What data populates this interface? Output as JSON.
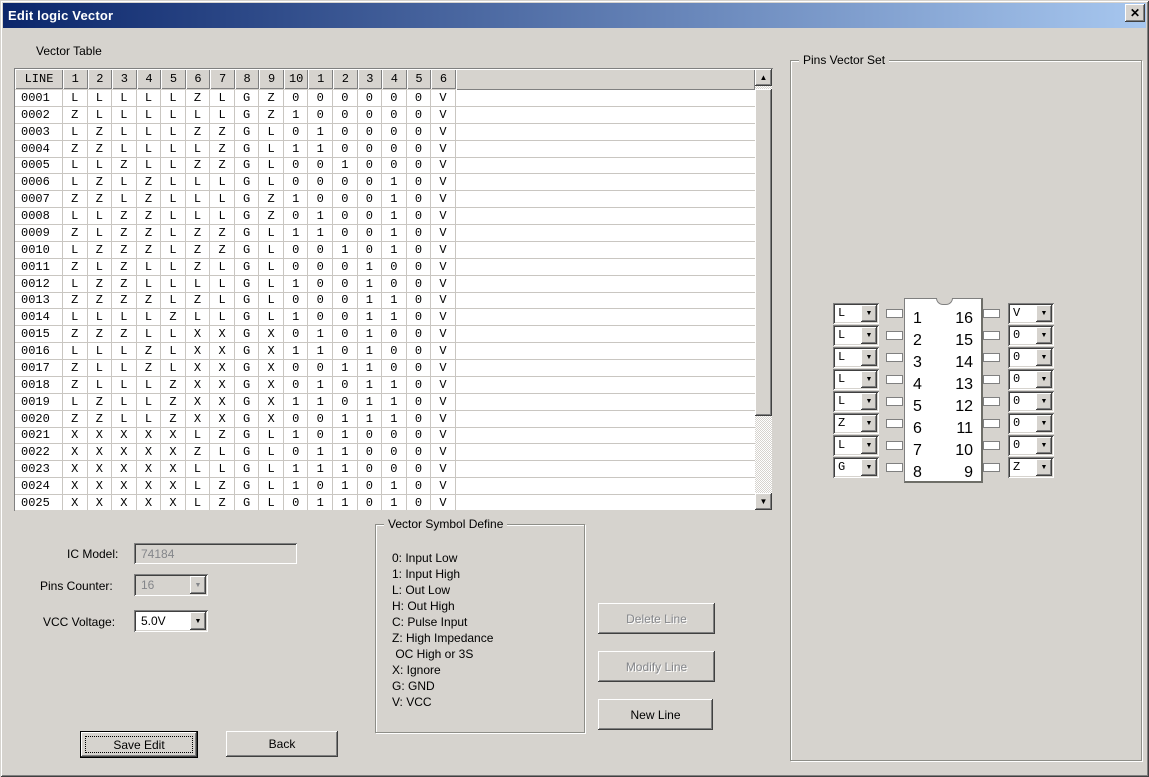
{
  "window": {
    "title": "Edit logic Vector",
    "close_glyph": "✕"
  },
  "vector_table": {
    "label": "Vector Table",
    "columns": [
      "LINE",
      "1",
      "2",
      "3",
      "4",
      "5",
      "6",
      "7",
      "8",
      "9",
      "10",
      "1",
      "2",
      "3",
      "4",
      "5",
      "6"
    ],
    "rows": [
      [
        "0001",
        "L",
        "L",
        "L",
        "L",
        "L",
        "Z",
        "L",
        "G",
        "Z",
        "0",
        "0",
        "0",
        "0",
        "0",
        "0",
        "V"
      ],
      [
        "0002",
        "Z",
        "L",
        "L",
        "L",
        "L",
        "L",
        "L",
        "G",
        "Z",
        "1",
        "0",
        "0",
        "0",
        "0",
        "0",
        "V"
      ],
      [
        "0003",
        "L",
        "Z",
        "L",
        "L",
        "L",
        "Z",
        "Z",
        "G",
        "L",
        "0",
        "1",
        "0",
        "0",
        "0",
        "0",
        "V"
      ],
      [
        "0004",
        "Z",
        "Z",
        "L",
        "L",
        "L",
        "L",
        "Z",
        "G",
        "L",
        "1",
        "1",
        "0",
        "0",
        "0",
        "0",
        "V"
      ],
      [
        "0005",
        "L",
        "L",
        "Z",
        "L",
        "L",
        "Z",
        "Z",
        "G",
        "L",
        "0",
        "0",
        "1",
        "0",
        "0",
        "0",
        "V"
      ],
      [
        "0006",
        "L",
        "Z",
        "L",
        "Z",
        "L",
        "L",
        "L",
        "G",
        "L",
        "0",
        "0",
        "0",
        "0",
        "1",
        "0",
        "V"
      ],
      [
        "0007",
        "Z",
        "Z",
        "L",
        "Z",
        "L",
        "L",
        "L",
        "G",
        "Z",
        "1",
        "0",
        "0",
        "0",
        "1",
        "0",
        "V"
      ],
      [
        "0008",
        "L",
        "L",
        "Z",
        "Z",
        "L",
        "L",
        "L",
        "G",
        "Z",
        "0",
        "1",
        "0",
        "0",
        "1",
        "0",
        "V"
      ],
      [
        "0009",
        "Z",
        "L",
        "Z",
        "Z",
        "L",
        "Z",
        "Z",
        "G",
        "L",
        "1",
        "1",
        "0",
        "0",
        "1",
        "0",
        "V"
      ],
      [
        "0010",
        "L",
        "Z",
        "Z",
        "Z",
        "L",
        "Z",
        "Z",
        "G",
        "L",
        "0",
        "0",
        "1",
        "0",
        "1",
        "0",
        "V"
      ],
      [
        "0011",
        "Z",
        "L",
        "Z",
        "L",
        "L",
        "Z",
        "L",
        "G",
        "L",
        "0",
        "0",
        "0",
        "1",
        "0",
        "0",
        "V"
      ],
      [
        "0012",
        "L",
        "Z",
        "Z",
        "L",
        "L",
        "L",
        "L",
        "G",
        "L",
        "1",
        "0",
        "0",
        "1",
        "0",
        "0",
        "V"
      ],
      [
        "0013",
        "Z",
        "Z",
        "Z",
        "Z",
        "L",
        "Z",
        "L",
        "G",
        "L",
        "0",
        "0",
        "0",
        "1",
        "1",
        "0",
        "V"
      ],
      [
        "0014",
        "L",
        "L",
        "L",
        "L",
        "Z",
        "L",
        "L",
        "G",
        "L",
        "1",
        "0",
        "0",
        "1",
        "1",
        "0",
        "V"
      ],
      [
        "0015",
        "Z",
        "Z",
        "Z",
        "L",
        "L",
        "X",
        "X",
        "G",
        "X",
        "0",
        "1",
        "0",
        "1",
        "0",
        "0",
        "V"
      ],
      [
        "0016",
        "L",
        "L",
        "L",
        "Z",
        "L",
        "X",
        "X",
        "G",
        "X",
        "1",
        "1",
        "0",
        "1",
        "0",
        "0",
        "V"
      ],
      [
        "0017",
        "Z",
        "L",
        "L",
        "Z",
        "L",
        "X",
        "X",
        "G",
        "X",
        "0",
        "0",
        "1",
        "1",
        "0",
        "0",
        "V"
      ],
      [
        "0018",
        "Z",
        "L",
        "L",
        "L",
        "Z",
        "X",
        "X",
        "G",
        "X",
        "0",
        "1",
        "0",
        "1",
        "1",
        "0",
        "V"
      ],
      [
        "0019",
        "L",
        "Z",
        "L",
        "L",
        "Z",
        "X",
        "X",
        "G",
        "X",
        "1",
        "1",
        "0",
        "1",
        "1",
        "0",
        "V"
      ],
      [
        "0020",
        "Z",
        "Z",
        "L",
        "L",
        "Z",
        "X",
        "X",
        "G",
        "X",
        "0",
        "0",
        "1",
        "1",
        "1",
        "0",
        "V"
      ],
      [
        "0021",
        "X",
        "X",
        "X",
        "X",
        "X",
        "L",
        "Z",
        "G",
        "L",
        "1",
        "0",
        "1",
        "0",
        "0",
        "0",
        "V"
      ],
      [
        "0022",
        "X",
        "X",
        "X",
        "X",
        "X",
        "Z",
        "L",
        "G",
        "L",
        "0",
        "1",
        "1",
        "0",
        "0",
        "0",
        "V"
      ],
      [
        "0023",
        "X",
        "X",
        "X",
        "X",
        "X",
        "L",
        "L",
        "G",
        "L",
        "1",
        "1",
        "1",
        "0",
        "0",
        "0",
        "V"
      ],
      [
        "0024",
        "X",
        "X",
        "X",
        "X",
        "X",
        "L",
        "Z",
        "G",
        "L",
        "1",
        "0",
        "1",
        "0",
        "1",
        "0",
        "V"
      ],
      [
        "0025",
        "X",
        "X",
        "X",
        "X",
        "X",
        "L",
        "Z",
        "G",
        "L",
        "0",
        "1",
        "1",
        "0",
        "1",
        "0",
        "V"
      ]
    ]
  },
  "pins_vector_set": {
    "label": "Pins Vector Set",
    "left_pins": [
      {
        "pin": "1",
        "value": "L"
      },
      {
        "pin": "2",
        "value": "L"
      },
      {
        "pin": "3",
        "value": "L"
      },
      {
        "pin": "4",
        "value": "L"
      },
      {
        "pin": "5",
        "value": "L"
      },
      {
        "pin": "6",
        "value": "Z"
      },
      {
        "pin": "7",
        "value": "L"
      },
      {
        "pin": "8",
        "value": "G"
      }
    ],
    "right_pins": [
      {
        "pin": "16",
        "value": "V"
      },
      {
        "pin": "15",
        "value": "0"
      },
      {
        "pin": "14",
        "value": "0"
      },
      {
        "pin": "13",
        "value": "0"
      },
      {
        "pin": "12",
        "value": "0"
      },
      {
        "pin": "11",
        "value": "0"
      },
      {
        "pin": "10",
        "value": "0"
      },
      {
        "pin": "9",
        "value": "Z"
      }
    ]
  },
  "controls": {
    "ic_model_label": "IC Model:",
    "ic_model_value": "74184",
    "pins_counter_label": "Pins Counter:",
    "pins_counter_value": "16",
    "vcc_voltage_label": "VCC Voltage:",
    "vcc_voltage_value": "5.0V"
  },
  "symbol_define": {
    "label": "Vector Symbol Define",
    "lines": [
      "0: Input Low",
      "1: Input High",
      "L: Out Low",
      "H: Out High",
      "C: Pulse Input",
      "Z: High Impedance",
      " OC High or 3S",
      "X: Ignore",
      "G: GND",
      "V: VCC"
    ]
  },
  "buttons": {
    "delete_line": "Delete Line",
    "modify_line": "Modify Line",
    "new_line": "New Line",
    "save_edit": "Save Edit",
    "back": "Back"
  },
  "icons": {
    "up_arrow": "▲",
    "down_arrow": "▼"
  },
  "colors": {
    "titlebar_left": "#0b266b",
    "titlebar_right": "#a7c7ef",
    "dialog_bg": "#d6d3ce",
    "disabled_text": "#84868a"
  }
}
